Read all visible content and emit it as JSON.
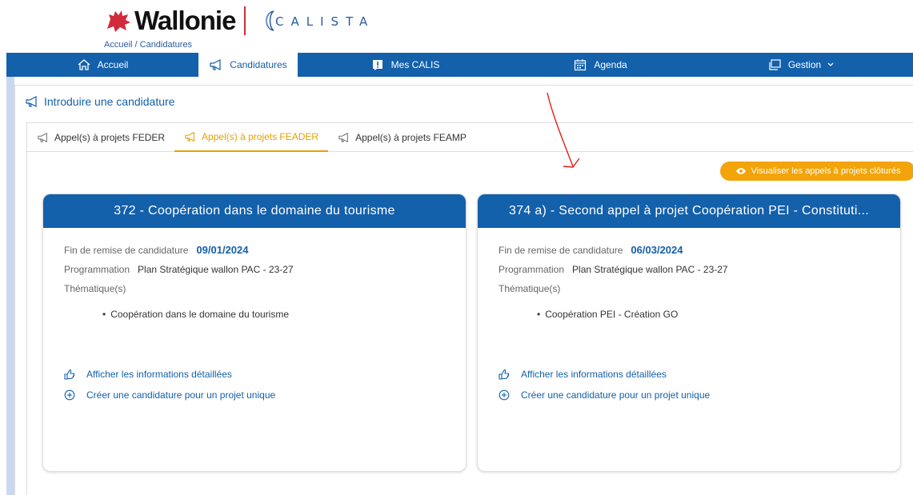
{
  "header": {
    "brand": "Wallonie",
    "app_name": "CALISTA",
    "breadcrumb": "Accueil / Candidatures"
  },
  "nav": {
    "items": [
      {
        "label": "Accueil",
        "icon": "home-icon"
      },
      {
        "label": "Candidatures",
        "icon": "megaphone-icon",
        "active": true
      },
      {
        "label": "Mes CALIS",
        "icon": "alert-box-icon"
      },
      {
        "label": "Agenda",
        "icon": "calendar-icon"
      },
      {
        "label": "Gestion",
        "icon": "windows-icon"
      }
    ]
  },
  "panel": {
    "title": "Introduire une candidature"
  },
  "tabs": [
    {
      "label": "Appel(s) à projets FEDER"
    },
    {
      "label": "Appel(s) à projets FEADER",
      "active": true
    },
    {
      "label": "Appel(s) à projets FEAMP"
    }
  ],
  "closed_button": {
    "label": "Visualiser les appels à projets clôturés"
  },
  "cards": [
    {
      "title": "372 - Coopération dans le domaine du tourisme",
      "deadline_label": "Fin de remise de candidature",
      "deadline": "09/01/2024",
      "programming_label": "Programmation",
      "programming": "Plan Stratégique wallon PAC - 23-27",
      "themes_label": "Thématique(s)",
      "themes": [
        "Coopération dans le domaine du tourisme"
      ],
      "link_details": "Afficher les informations détaillées",
      "link_create": "Créer une candidature pour un projet unique"
    },
    {
      "title": "374 a) - Second appel à projet Coopération PEI - Constituti...",
      "deadline_label": "Fin de remise de candidature",
      "deadline": "06/03/2024",
      "programming_label": "Programmation",
      "programming": "Plan Stratégique wallon PAC - 23-27",
      "themes_label": "Thématique(s)",
      "themes": [
        "Coopération PEI - Création GO"
      ],
      "link_details": "Afficher les informations détaillées",
      "link_create": "Créer une candidature pour un projet unique"
    }
  ],
  "colors": {
    "primary": "#1360ab",
    "accent": "#f2a40a",
    "active_tab": "#e6a100",
    "brand_red": "#d02b3a"
  }
}
